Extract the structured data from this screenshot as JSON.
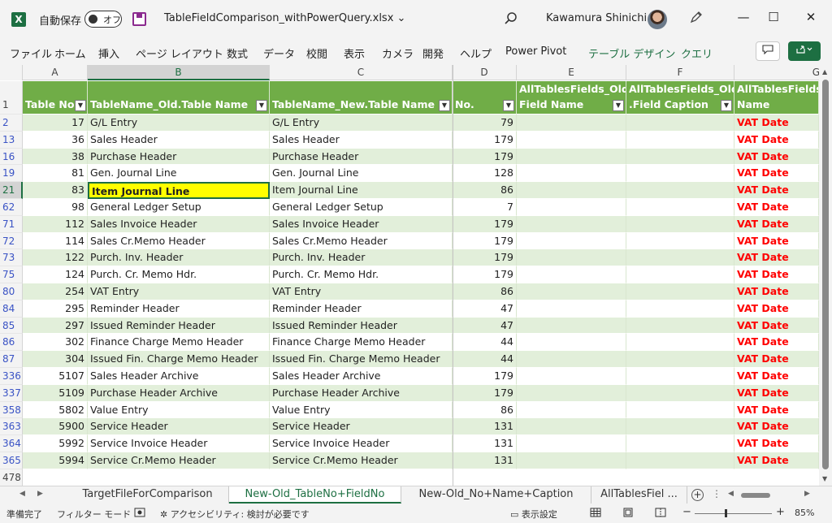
{
  "title_bar": {
    "app_logo": "X",
    "autosave_label": "自動保存",
    "autosave_state": "オフ",
    "filename": "TableFieldComparison_withPowerQuery.xlsx",
    "filename_chevron": "⌄",
    "user_name": "Kawamura Shinichi",
    "minimize": "—",
    "maximize": "☐",
    "close": "✕"
  },
  "ribbon": {
    "tabs": [
      "ファイル",
      "ホーム",
      "挿入",
      "ページ レイアウト",
      "数式",
      "データ",
      "校閲",
      "表示",
      "カメラ",
      "開発",
      "ヘルプ",
      "Power Pivot",
      "テーブル デザイン",
      "クエリ"
    ],
    "comment_icon": "comment-icon",
    "share_icon": "share-icon"
  },
  "columns": [
    "A",
    "B",
    "C",
    "D",
    "E",
    "F",
    "G"
  ],
  "header_row": {
    "row_number": "1",
    "a": "Table No.",
    "b": "TableName_Old.Table Name",
    "c": "TableName_New.Table Name",
    "d": "No.",
    "e_line1": "AllTablesFields_Old.",
    "e_line2": "Field Name",
    "f_line1": "AllTablesFields_Old",
    "f_line2": ".Field Caption",
    "g_line1": "AllTablesFields_",
    "g_line2": "Name"
  },
  "rows": [
    {
      "row": "2",
      "a": "17",
      "b": "G/L Entry",
      "c": "G/L Entry",
      "d": "79",
      "g": "VAT Date"
    },
    {
      "row": "13",
      "a": "36",
      "b": "Sales Header",
      "c": "Sales Header",
      "d": "179",
      "g": "VAT Date"
    },
    {
      "row": "16",
      "a": "38",
      "b": "Purchase Header",
      "c": "Purchase Header",
      "d": "179",
      "g": "VAT Date"
    },
    {
      "row": "19",
      "a": "81",
      "b": "Gen. Journal Line",
      "c": "Gen. Journal Line",
      "d": "128",
      "g": "VAT Date"
    },
    {
      "row": "21",
      "a": "83",
      "b": "Item Journal Line",
      "c": "Item Journal Line",
      "d": "86",
      "g": "VAT Date"
    },
    {
      "row": "62",
      "a": "98",
      "b": "General Ledger Setup",
      "c": "General Ledger Setup",
      "d": "7",
      "g": "VAT Date"
    },
    {
      "row": "71",
      "a": "112",
      "b": "Sales Invoice Header",
      "c": "Sales Invoice Header",
      "d": "179",
      "g": "VAT Date"
    },
    {
      "row": "72",
      "a": "114",
      "b": "Sales Cr.Memo Header",
      "c": "Sales Cr.Memo Header",
      "d": "179",
      "g": "VAT Date"
    },
    {
      "row": "73",
      "a": "122",
      "b": "Purch. Inv. Header",
      "c": "Purch. Inv. Header",
      "d": "179",
      "g": "VAT Date"
    },
    {
      "row": "75",
      "a": "124",
      "b": "Purch. Cr. Memo Hdr.",
      "c": "Purch. Cr. Memo Hdr.",
      "d": "179",
      "g": "VAT Date"
    },
    {
      "row": "80",
      "a": "254",
      "b": "VAT Entry",
      "c": "VAT Entry",
      "d": "86",
      "g": "VAT Date"
    },
    {
      "row": "84",
      "a": "295",
      "b": "Reminder Header",
      "c": "Reminder Header",
      "d": "47",
      "g": "VAT Date"
    },
    {
      "row": "85",
      "a": "297",
      "b": "Issued Reminder Header",
      "c": "Issued Reminder Header",
      "d": "47",
      "g": "VAT Date"
    },
    {
      "row": "86",
      "a": "302",
      "b": "Finance Charge Memo Header",
      "c": "Finance Charge Memo Header",
      "d": "44",
      "g": "VAT Date"
    },
    {
      "row": "87",
      "a": "304",
      "b": "Issued Fin. Charge Memo Header",
      "c": "Issued Fin. Charge Memo Header",
      "d": "44",
      "g": "VAT Date"
    },
    {
      "row": "336",
      "a": "5107",
      "b": "Sales Header Archive",
      "c": "Sales Header Archive",
      "d": "179",
      "g": "VAT Date"
    },
    {
      "row": "337",
      "a": "5109",
      "b": "Purchase Header Archive",
      "c": "Purchase Header Archive",
      "d": "179",
      "g": "VAT Date"
    },
    {
      "row": "358",
      "a": "5802",
      "b": "Value Entry",
      "c": "Value Entry",
      "d": "86",
      "g": "VAT Date"
    },
    {
      "row": "363",
      "a": "5900",
      "b": "Service Header",
      "c": "Service Header",
      "d": "131",
      "g": "VAT Date"
    },
    {
      "row": "364",
      "a": "5992",
      "b": "Service Invoice Header",
      "c": "Service Invoice Header",
      "d": "131",
      "g": "VAT Date"
    },
    {
      "row": "365",
      "a": "5994",
      "b": "Service Cr.Memo Header",
      "c": "Service Cr.Memo Header",
      "d": "131",
      "g": "VAT Date"
    }
  ],
  "last_row_number": "478",
  "selected_cell": {
    "row": "21",
    "column": "B"
  },
  "sheet_tabs": [
    "TargetFileForComparison",
    "New-Old_TableNo+FieldNo",
    "New-Old_No+Name+Caption",
    "AllTablesFiel ..."
  ],
  "active_sheet_index": 1,
  "status": {
    "ready": "準備完了",
    "filter_mode": "フィルター モード",
    "accessibility": "アクセシビリティ: 検討が必要です",
    "display_settings": "表示設定",
    "zoom_minus": "−",
    "zoom_plus": "+",
    "zoom": "85%"
  },
  "colors": {
    "header_green": "#70ad47",
    "band_green": "#e2efda",
    "vat_red": "#ff0000",
    "highlight_yellow": "#ffff00",
    "excel_green": "#1d6f42"
  }
}
